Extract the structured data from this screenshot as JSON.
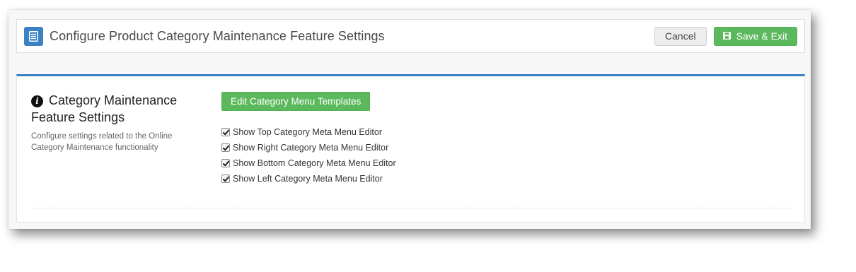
{
  "header": {
    "title": "Configure Product Category Maintenance Feature Settings",
    "icon": "document-icon",
    "cancel_label": "Cancel",
    "save_label": "Save & Exit"
  },
  "section": {
    "title": "Category Maintenance Feature Settings",
    "icon": "info-icon",
    "description": "Configure settings related to the Online Category Maintenance functionality",
    "templates_button_label": "Edit Category Menu Templates",
    "checkboxes": [
      {
        "label": "Show Top Category Meta Menu Editor",
        "checked": true
      },
      {
        "label": "Show Right Category Meta Menu Editor",
        "checked": true
      },
      {
        "label": "Show Bottom Category Meta Menu Editor",
        "checked": true
      },
      {
        "label": "Show Left Category Meta Menu Editor",
        "checked": true
      }
    ]
  },
  "colors": {
    "accent_blue": "#3a7fc1",
    "success_green": "#5cb85c"
  }
}
